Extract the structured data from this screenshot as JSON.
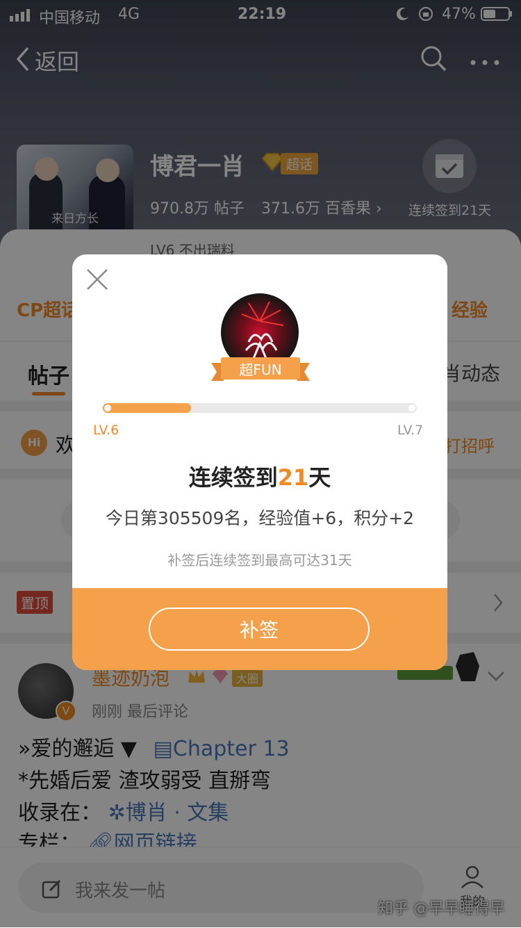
{
  "status_bar": {
    "carrier": "中国移动",
    "network": "4G",
    "time": "22:19",
    "battery": "47%"
  },
  "nav": {
    "back_label": "返回"
  },
  "topic": {
    "name": "博君一肖",
    "badge": "超话",
    "posts_count": "970.8万",
    "posts_label": "帖子",
    "fans_count": "371.6万",
    "fans_label": "百香果",
    "level_text": "LV6 不出瑞料",
    "checkin_label": "连续签到21天",
    "cover_caption": "来日方长"
  },
  "background": {
    "cp_label": "CP超话",
    "exp_label": "经验",
    "tab_posts": "帖子",
    "tab_dynamic": "肖动态",
    "welcome_text": "欢",
    "hi_badge": "Hi",
    "greet_text": "打招呼",
    "pin_label": "置顶"
  },
  "post": {
    "username": "墨迹奶泡",
    "user_badge": "大圈",
    "meta": "刚刚 最后评论",
    "line1_prefix": "»爱的邂逅 ▼",
    "line1_link": "Chapter 13",
    "line2": "*先婚后爱 渣攻弱受 直掰弯",
    "line3_prefix": "收录在：",
    "line3_link": "博肖 · 文集",
    "line4_prefix": "专栏：",
    "line4_link": "网页链接"
  },
  "bottom_bar": {
    "compose_placeholder": "我来发一帖",
    "watermark": "知乎 @早早睡得早",
    "my_label": "我的"
  },
  "modal": {
    "badge_label": "超FUN",
    "level_from": "LV.6",
    "level_to": "LV.7",
    "progress": 0.28,
    "title_prefix": "连续签到",
    "title_days": "21",
    "title_suffix": "天",
    "stats": "今日第305509名，经验值+6，积分+2",
    "note": "补签后连续签到最高可达31天",
    "action_label": "补签"
  },
  "colors": {
    "accent": "#f5a04b",
    "progress_bg": "#e8e8e8",
    "title_highlight": "#f5a04b"
  }
}
